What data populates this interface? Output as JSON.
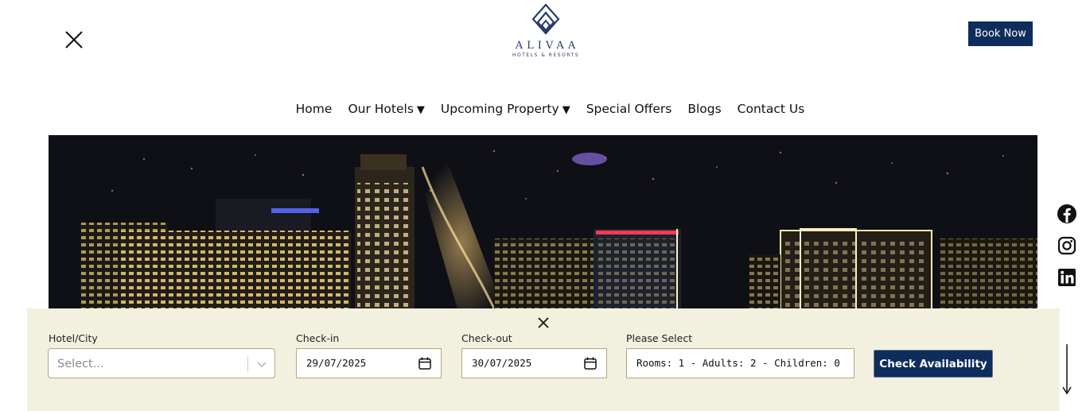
{
  "header": {
    "logo_name": "ALIVAA",
    "logo_sub": "HOTELS & RESORTS",
    "book_now_label": "Book Now"
  },
  "nav": {
    "items": [
      {
        "label": "Home",
        "has_dropdown": false
      },
      {
        "label": "Our Hotels",
        "has_dropdown": true
      },
      {
        "label": "Upcoming Property",
        "has_dropdown": true
      },
      {
        "label": "Special Offers",
        "has_dropdown": false
      },
      {
        "label": "Blogs",
        "has_dropdown": false
      },
      {
        "label": "Contact Us",
        "has_dropdown": false
      }
    ],
    "caret": "▼"
  },
  "hero": {
    "image": "night-city-skyline"
  },
  "social": [
    "facebook-icon",
    "instagram-icon",
    "linkedin-icon"
  ],
  "booking": {
    "hotel_label": "Hotel/City",
    "hotel_placeholder": "Select...",
    "checkin_label": "Check-in",
    "checkin_value": "29/07/2025",
    "checkout_label": "Check-out",
    "checkout_value": "30/07/2025",
    "rooms_label": "Please Select",
    "rooms_value": "Rooms: 1 - Adults: 2 - Children: 0",
    "button_label": "Check Availability"
  },
  "colors": {
    "brand_navy": "#0e2d5c",
    "booking_bg": "#f2f1df",
    "logo_blue": "#2a3b6b"
  }
}
